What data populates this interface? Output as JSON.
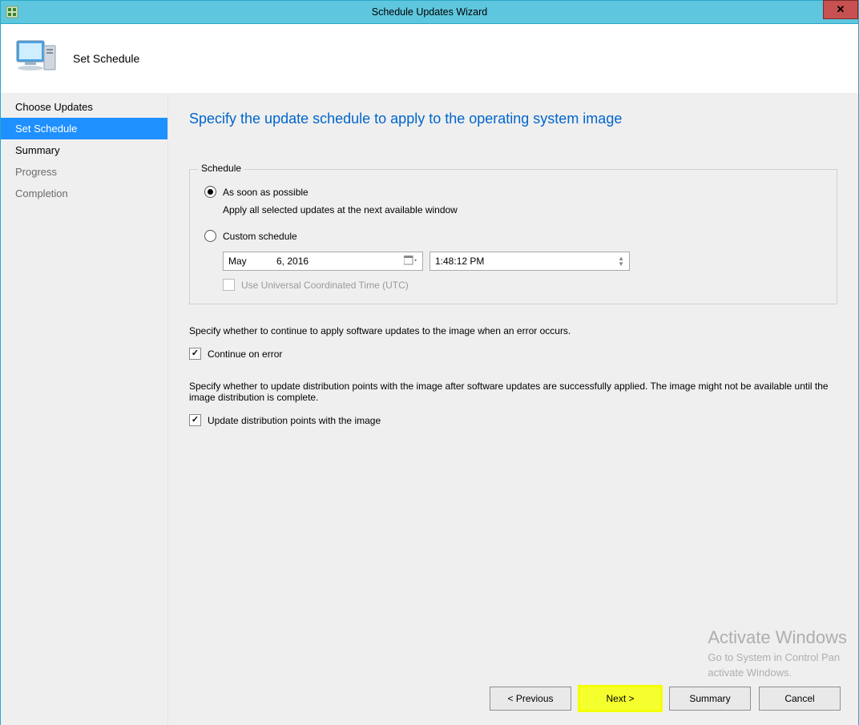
{
  "window": {
    "title": "Schedule Updates Wizard"
  },
  "header": {
    "title": "Set Schedule"
  },
  "sidebar": {
    "items": [
      {
        "label": "Choose Updates",
        "state": "normal"
      },
      {
        "label": "Set Schedule",
        "state": "selected"
      },
      {
        "label": "Summary",
        "state": "normal"
      },
      {
        "label": "Progress",
        "state": "muted"
      },
      {
        "label": "Completion",
        "state": "muted"
      }
    ]
  },
  "page": {
    "heading": "Specify the update schedule to apply to the operating system image",
    "schedule_group": {
      "legend": "Schedule",
      "asap_label": "As soon as possible",
      "asap_desc": "Apply all selected updates at the next available window",
      "custom_label": "Custom schedule",
      "selected": "asap",
      "date_month": "May",
      "date_dayyear": "6, 2016",
      "time_value": "1:48:12 PM",
      "utc_label": "Use Universal Coordinated Time (UTC)",
      "utc_checked": false,
      "utc_enabled": false
    },
    "error_para": "Specify whether to continue to apply software updates to the image when an error occurs.",
    "continue_label": "Continue on error",
    "continue_checked": true,
    "dp_para": "Specify whether to update distribution points with the image after software updates are successfully applied. The image might not be available until the image distribution is complete.",
    "dp_label": "Update distribution points with the image",
    "dp_checked": true
  },
  "buttons": {
    "previous": "< Previous",
    "next": "Next >",
    "summary": "Summary",
    "cancel": "Cancel"
  },
  "watermark": {
    "title": "Activate Windows",
    "sub1": "Go to System in Control Pan",
    "sub2": "activate Windows."
  }
}
